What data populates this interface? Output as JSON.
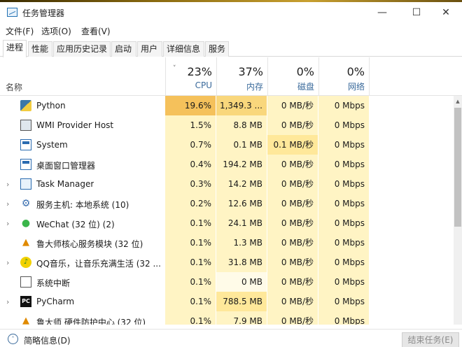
{
  "window": {
    "title": "任务管理器",
    "minimize": "—",
    "maximize": "☐",
    "close": "✕"
  },
  "menu": [
    "文件(F)",
    "选项(O)",
    "查看(V)"
  ],
  "tabs": [
    "进程",
    "性能",
    "应用历史记录",
    "启动",
    "用户",
    "详细信息",
    "服务"
  ],
  "active_tab": "进程",
  "columns": {
    "name": "名称",
    "cpu": {
      "pct": "23%",
      "label": "CPU"
    },
    "memory": {
      "pct": "37%",
      "label": "内存"
    },
    "disk": {
      "pct": "0%",
      "label": "磁盘"
    },
    "network": {
      "pct": "0%",
      "label": "网络"
    }
  },
  "sort_indicator": "˅",
  "processes": [
    {
      "name": "Python",
      "expand": "",
      "icon": "python-icon",
      "glyph": "",
      "cpu": "19.6%",
      "mem": "1,349.3 ...",
      "disk": "0 MB/秒",
      "net": "0 Mbps"
    },
    {
      "name": "WMI Provider Host",
      "expand": "",
      "icon": "wmi-icon",
      "glyph": "",
      "cpu": "1.5%",
      "mem": "8.8 MB",
      "disk": "0 MB/秒",
      "net": "0 Mbps"
    },
    {
      "name": "System",
      "expand": "",
      "icon": "system-icon",
      "glyph": "",
      "cpu": "0.7%",
      "mem": "0.1 MB",
      "disk": "0.1 MB/秒",
      "net": "0 Mbps"
    },
    {
      "name": "桌面窗口管理器",
      "expand": "",
      "icon": "dwm-icon",
      "glyph": "",
      "cpu": "0.4%",
      "mem": "194.2 MB",
      "disk": "0 MB/秒",
      "net": "0 Mbps"
    },
    {
      "name": "Task Manager",
      "expand": "›",
      "icon": "task-manager-icon",
      "glyph": "",
      "cpu": "0.3%",
      "mem": "14.2 MB",
      "disk": "0 MB/秒",
      "net": "0 Mbps"
    },
    {
      "name": "服务主机: 本地系统 (10)",
      "expand": "›",
      "icon": "gear-icon",
      "glyph": "⚙",
      "cpu": "0.2%",
      "mem": "12.6 MB",
      "disk": "0 MB/秒",
      "net": "0 Mbps"
    },
    {
      "name": "WeChat (32 位) (2)",
      "expand": "›",
      "icon": "wechat-icon",
      "glyph": "●",
      "cpu": "0.1%",
      "mem": "24.1 MB",
      "disk": "0 MB/秒",
      "net": "0 Mbps"
    },
    {
      "name": "鲁大师核心服务模块 (32 位)",
      "expand": "",
      "icon": "ludashi-icon",
      "glyph": "▲",
      "cpu": "0.1%",
      "mem": "1.3 MB",
      "disk": "0 MB/秒",
      "net": "0 Mbps"
    },
    {
      "name": "QQ音乐，让音乐充满生活 (32 ...",
      "expand": "›",
      "icon": "qqmusic-icon",
      "glyph": "♪",
      "cpu": "0.1%",
      "mem": "31.8 MB",
      "disk": "0 MB/秒",
      "net": "0 Mbps"
    },
    {
      "name": "系统中断",
      "expand": "",
      "icon": "interrupt-icon",
      "glyph": "",
      "cpu": "0.1%",
      "mem": "0 MB",
      "disk": "0 MB/秒",
      "net": "0 Mbps"
    },
    {
      "name": "PyCharm",
      "expand": "›",
      "icon": "pycharm-icon",
      "glyph": "PC",
      "cpu": "0.1%",
      "mem": "788.5 MB",
      "disk": "0 MB/秒",
      "net": "0 Mbps"
    },
    {
      "name": "鲁大师 硬件防护中心 (32 位)",
      "expand": "",
      "icon": "ludashi-icon",
      "glyph": "▲",
      "cpu": "0.1%",
      "mem": "7.9 MB",
      "disk": "0 MB/秒",
      "net": "0 Mbps"
    }
  ],
  "footer": {
    "fewer_details": "简略信息(D)",
    "fewer_icon": "˄",
    "end_task": "结束任务(E)"
  }
}
